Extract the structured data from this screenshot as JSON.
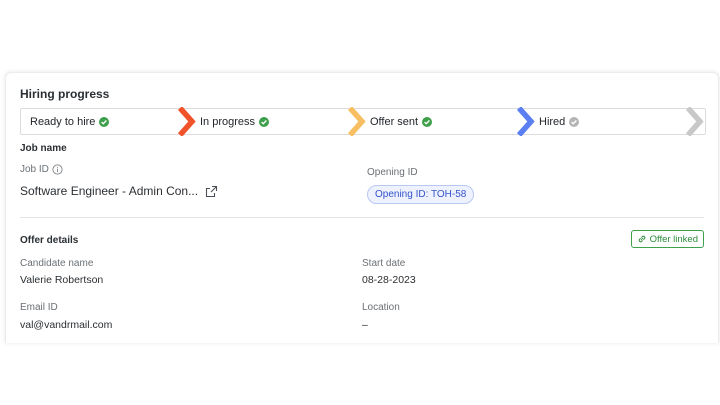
{
  "header": {
    "title": "Hiring progress"
  },
  "stepper": {
    "steps": [
      {
        "label": "Ready to hire",
        "status": "complete"
      },
      {
        "label": "In progress",
        "status": "complete"
      },
      {
        "label": "Offer sent",
        "status": "complete"
      },
      {
        "label": "Hired",
        "status": "pending"
      }
    ],
    "colors": {
      "chevron_1": "#f0532a",
      "chevron_2": "#f8bf62",
      "chevron_3": "#5b7ff2",
      "chevron_4": "#c8c8c8",
      "check_complete": "#3ea04a",
      "check_pending": "#b4b4b4"
    }
  },
  "job": {
    "section_label": "Job name",
    "job_id_label": "Job ID",
    "job_title": "Software Engineer - Admin Con...",
    "opening_id_label": "Opening ID",
    "opening_id_pill": "Opening ID: TOH-58"
  },
  "offer": {
    "section_label": "Offer details",
    "badge": "Offer linked",
    "candidate_name_label": "Candidate name",
    "candidate_name": "Valerie Robertson",
    "start_date_label": "Start date",
    "start_date": "08-28-2023",
    "email_label": "Email ID",
    "email": "val@vandrmail.com",
    "location_label": "Location",
    "location": "–"
  }
}
